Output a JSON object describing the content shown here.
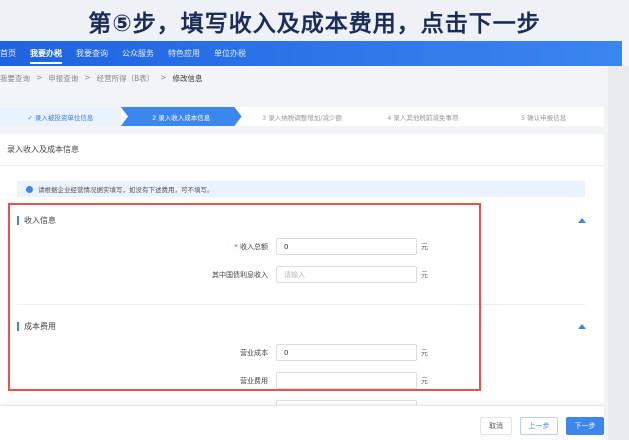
{
  "banner": {
    "text": "第⑤步，填写收入及成本费用，点击下一步"
  },
  "nav": {
    "items": [
      "首页",
      "我要办税",
      "我要查询",
      "公众服务",
      "特色应用",
      "单位办税"
    ],
    "active": 1
  },
  "breadcrumb": [
    "我要查询",
    ">",
    "申报查询",
    ">",
    "经营所得（B表）",
    ">",
    "修改信息"
  ],
  "steps": [
    "✓ 录入被投资单位信息",
    "2  录入收入成本信息",
    "3  录入纳税调整增加/减少额",
    "4  录入其他税前减免事项",
    "5  确认申报信息"
  ],
  "card": {
    "title": "录入收入及成本信息",
    "notice": "请根据企业经营情况据实填写，如没有下述费用，可不填写。"
  },
  "income": {
    "title": "收入信息",
    "fields": [
      {
        "required": "*",
        "label": "收入总额",
        "value": "0",
        "placeholder": "",
        "unit": "元"
      },
      {
        "label": "其中国债利息收入",
        "value": "",
        "placeholder": "请输入",
        "unit": "元"
      }
    ]
  },
  "cost": {
    "title": "成本费用",
    "fields": [
      {
        "label": "营业成本",
        "value": "0",
        "unit": "元"
      },
      {
        "label": "营业费用",
        "value": "",
        "unit": "元"
      }
    ]
  },
  "footer": {
    "cancel": "取消",
    "prev": "上一步",
    "next": "下一步"
  },
  "colors": {
    "primary": "#3d86ee",
    "highlight": "#e8524a"
  }
}
